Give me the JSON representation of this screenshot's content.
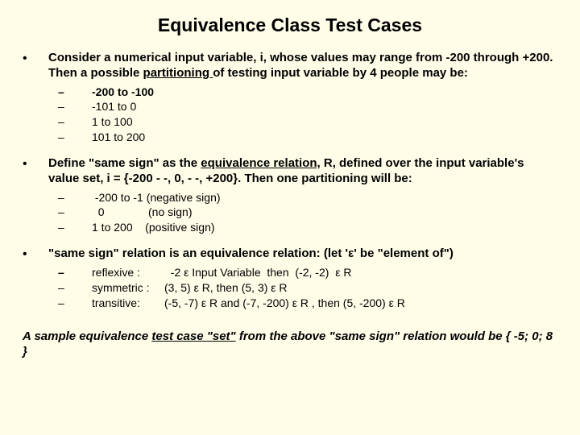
{
  "title": "Equivalence Class Test Cases",
  "b1": {
    "lead": "Consider a numerical input variable, i, whose values may range from -200 through +200. Then a possible ",
    "underlined": "partitioning ",
    "tail": " of testing input variable by 4 people may be:",
    "s1": "-200 to -100",
    "s2": " -101 to 0",
    "s3": " 1  to 100",
    "s4": " 101 to 200"
  },
  "b2": {
    "p1": "Define \"same sign\" as the ",
    "u1": "equivalence relation,",
    "p2": " R, defined over the input variable's value set, i = {-200 - -, 0, - -, +200}. Then one partitioning will be:",
    "s1": " -200 to -1 (negative sign)",
    "s2": "  0              (no sign)",
    "s3": "1 to 200    (positive sign)"
  },
  "b3": {
    "lead": "\"same sign\" relation is an equivalence relation:  (let 'ε' be \"element of\")",
    "r_label": "reflexive :",
    "r_text": "  -2 ε Input Variable  then  (-2, -2)  ε R",
    "s_label": "symmetric :",
    "s_text": "(3, 5) ε R, then (5, 3)  ε R",
    "t_label": "transitive:",
    "t_text": "(-5, -7)  ε R and (-7, -200) ε R , then (5, -200) ε R"
  },
  "footer": {
    "p1": "A sample equivalence ",
    "u": "test case \"set\"",
    "p2": " from the above \"same sign\" relation would be { -5; 0; 8 }"
  }
}
